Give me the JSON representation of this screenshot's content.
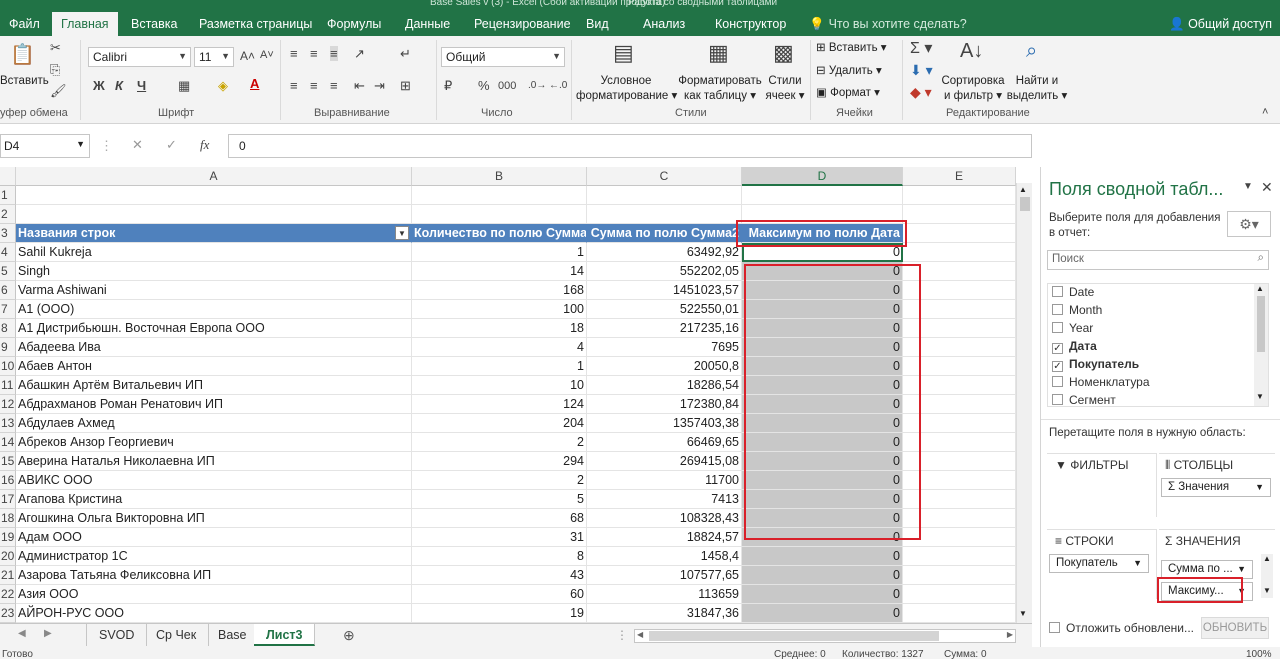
{
  "title": {
    "left": "Base Sales v (3) - Excel (Сбой активации продукта)",
    "right": "Работа со сводными таблицами"
  },
  "tabs": [
    "Файл",
    "Главная",
    "Вставка",
    "Разметка страницы",
    "Формулы",
    "Данные",
    "Рецензирование",
    "Вид",
    "Анализ",
    "Конструктор"
  ],
  "tell_me": "Что вы хотите сделать?",
  "share": "Общий доступ",
  "ribbon": {
    "paste": "Вставить",
    "clipboard": "уфер обмена",
    "font_name": "Calibri",
    "font_size": "11",
    "font_group": "Шрифт",
    "bold": "Ж",
    "italic": "К",
    "underline": "Ч",
    "align_group": "Выравнивание",
    "number_format": "Общий",
    "number_group": "Число",
    "cond_format": "Условное",
    "cond_format2": "форматирование",
    "fmt_table": "Форматировать",
    "fmt_table2": "как таблицу",
    "cell_styles": "Стили",
    "cell_styles2": "ячеек",
    "styles_group": "Стили",
    "insert": "Вставить",
    "delete": "Удалить",
    "format": "Формат",
    "cells_group": "Ячейки",
    "sort": "Сортировка",
    "sort2": "и фильтр",
    "find": "Найти и",
    "find2": "выделить",
    "edit_group": "Редактирование"
  },
  "formula_bar": {
    "cell_ref": "D4",
    "fx": "fx",
    "value": "0"
  },
  "columns": [
    "A",
    "B",
    "C",
    "D",
    "E"
  ],
  "pivot_headers": {
    "a": "Названия строк",
    "b": "Количество по полю Сумма",
    "c": "Сумма по полю Сумма2",
    "d": "Максимум по полю Дата"
  },
  "rows": [
    {
      "n": "4",
      "name": "Sahil Kukreja",
      "qty": "1",
      "sum": "63492,92",
      "max": "0"
    },
    {
      "n": "5",
      "name": "Singh",
      "qty": "14",
      "sum": "552202,05",
      "max": "0"
    },
    {
      "n": "6",
      "name": "Varma Ashiwani",
      "qty": "168",
      "sum": "1451023,57",
      "max": "0"
    },
    {
      "n": "7",
      "name": "А1 (ООО)",
      "qty": "100",
      "sum": "522550,01",
      "max": "0"
    },
    {
      "n": "8",
      "name": "А1 Дистрибьюшн. Восточная Европа ООО",
      "qty": "18",
      "sum": "217235,16",
      "max": "0"
    },
    {
      "n": "9",
      "name": "Абадеева Ива",
      "qty": "4",
      "sum": "7695",
      "max": "0"
    },
    {
      "n": "10",
      "name": "Абаев Антон",
      "qty": "1",
      "sum": "20050,8",
      "max": "0"
    },
    {
      "n": "11",
      "name": "Абашкин Артём Витальевич ИП",
      "qty": "10",
      "sum": "18286,54",
      "max": "0"
    },
    {
      "n": "12",
      "name": "Абдрахманов Роман Ренатович ИП",
      "qty": "124",
      "sum": "172380,84",
      "max": "0"
    },
    {
      "n": "13",
      "name": "Абдулаев Ахмед",
      "qty": "204",
      "sum": "1357403,38",
      "max": "0"
    },
    {
      "n": "14",
      "name": "Абреков Анзор Георгиевич",
      "qty": "2",
      "sum": "66469,65",
      "max": "0"
    },
    {
      "n": "15",
      "name": "Аверина Наталья Николаевна ИП",
      "qty": "294",
      "sum": "269415,08",
      "max": "0"
    },
    {
      "n": "16",
      "name": "АВИКС ООО",
      "qty": "2",
      "sum": "11700",
      "max": "0"
    },
    {
      "n": "17",
      "name": "Агапова Кристина",
      "qty": "5",
      "sum": "7413",
      "max": "0"
    },
    {
      "n": "18",
      "name": "Агошкина Ольга Викторовна ИП",
      "qty": "68",
      "sum": "108328,43",
      "max": "0"
    },
    {
      "n": "19",
      "name": "Адам ООО",
      "qty": "31",
      "sum": "18824,57",
      "max": "0"
    },
    {
      "n": "20",
      "name": "Администратор 1С",
      "qty": "8",
      "sum": "1458,4",
      "max": "0"
    },
    {
      "n": "21",
      "name": "Азарова Татьяна Феликсовна ИП",
      "qty": "43",
      "sum": "107577,65",
      "max": "0"
    },
    {
      "n": "22",
      "name": "Азия ООО",
      "qty": "60",
      "sum": "113659",
      "max": "0"
    },
    {
      "n": "23",
      "name": "АЙРОН-РУС ООО",
      "qty": "19",
      "sum": "31847,36",
      "max": "0"
    }
  ],
  "sheet_tabs": [
    "SVOD",
    "Ср Чек",
    "Base",
    "Лист3"
  ],
  "status": {
    "ready": "Готово",
    "avg": "Среднее: 0",
    "count": "Количество: 1327",
    "sum": "Сумма: 0",
    "zoom": "100%"
  },
  "panel": {
    "title": "Поля сводной табл...",
    "choose": "Выберите поля для добавления",
    "choose2": "в отчет:",
    "search_placeholder": "Поиск",
    "fields": [
      {
        "label": "Date",
        "checked": false,
        "bold": false
      },
      {
        "label": "Month",
        "checked": false,
        "bold": false
      },
      {
        "label": "Year",
        "checked": false,
        "bold": false
      },
      {
        "label": "Дата",
        "checked": true,
        "bold": true
      },
      {
        "label": "Покупатель",
        "checked": true,
        "bold": true
      },
      {
        "label": "Номенклатура",
        "checked": false,
        "bold": false
      },
      {
        "label": "Сегмент",
        "checked": false,
        "bold": false
      }
    ],
    "drag_hint": "Перетащите поля в нужную область:",
    "filters": "ФИЛЬТРЫ",
    "columns": "СТОЛБЦЫ",
    "columns_value": "Σ  Значения",
    "rows": "СТРОКИ",
    "rows_value": "Покупатель",
    "values": "ЗНАЧЕНИЯ",
    "values_item1": "Сумма по ...",
    "values_item2": "Максиму...",
    "defer": "Отложить обновлени...",
    "update": "ОБНОВИТЬ"
  }
}
